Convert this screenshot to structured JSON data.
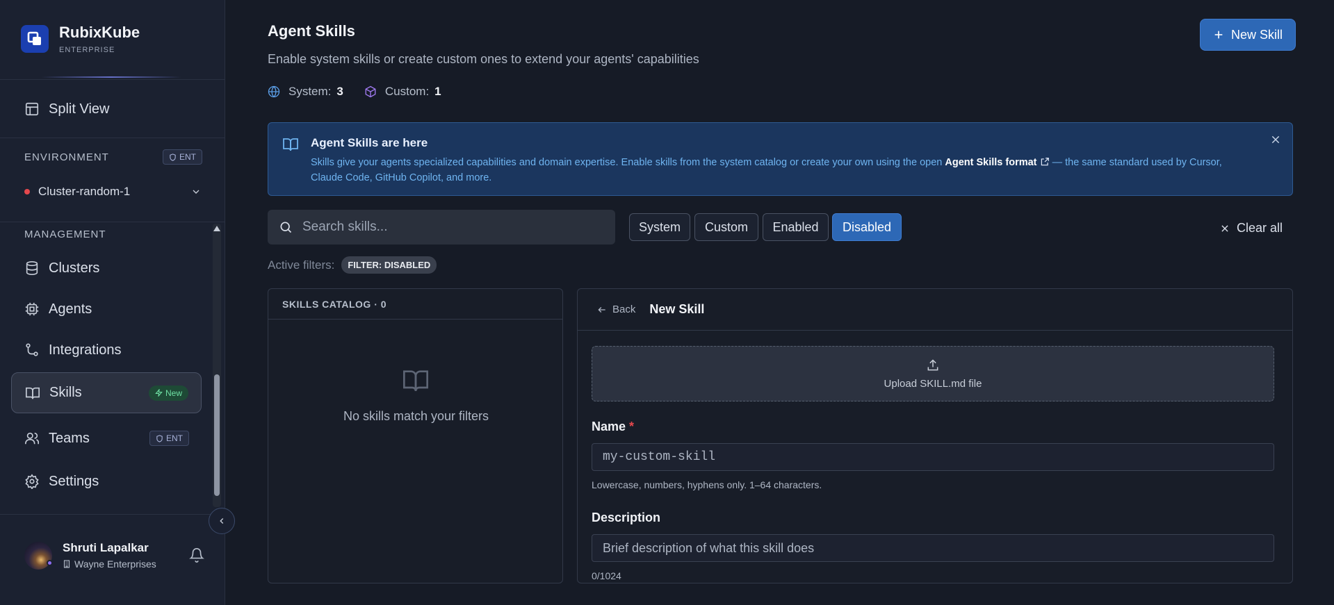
{
  "brand": {
    "name": "RubixKube",
    "sub": "ENTERPRISE"
  },
  "sidebar": {
    "split_view": "Split View",
    "environment_label": "ENVIRONMENT",
    "ent_badge": "ENT",
    "cluster": "Cluster-random-1",
    "cluster_status_color": "#e5484d",
    "management_label": "MANAGEMENT",
    "items": [
      {
        "label": "Clusters",
        "icon": "database-icon"
      },
      {
        "label": "Agents",
        "icon": "cpu-icon"
      },
      {
        "label": "Integrations",
        "icon": "git-branch-icon"
      },
      {
        "label": "Skills",
        "icon": "book-open-icon",
        "badge": "New",
        "active": true
      },
      {
        "label": "Teams",
        "icon": "users-icon",
        "badge": "ENT"
      },
      {
        "label": "Settings",
        "icon": "gear-icon"
      }
    ]
  },
  "user": {
    "name": "Shruti Lapalkar",
    "org": "Wayne Enterprises"
  },
  "header": {
    "title": "Agent Skills",
    "subtitle": "Enable system skills or create custom ones to extend your agents' capabilities",
    "system_label": "System:",
    "system_count": "3",
    "custom_label": "Custom:",
    "custom_count": "1",
    "new_skill_button": "New Skill"
  },
  "banner": {
    "title": "Agent Skills are here",
    "text_before": "Skills give your agents specialized capabilities and domain expertise. Enable skills from the system catalog or create your own using the open ",
    "link": "Agent Skills format",
    "text_after": " — the same standard used by Cursor, Claude Code, GitHub Copilot, and more."
  },
  "search": {
    "placeholder": "Search skills...",
    "value": ""
  },
  "filters": {
    "chips": [
      "System",
      "Custom",
      "Enabled",
      "Disabled"
    ],
    "active_chip": "Disabled",
    "clear_all": "Clear all",
    "active_label": "Active filters:",
    "active_tag": "FILTER: DISABLED"
  },
  "catalog": {
    "title": "SKILLS CATALOG · 0",
    "empty": "No skills match your filters"
  },
  "editor": {
    "back": "Back",
    "title": "New Skill",
    "upload": "Upload SKILL.md file",
    "name_label": "Name",
    "required_mark": "*",
    "name_placeholder": "my-custom-skill",
    "name_hint": "Lowercase, numbers, hyphens only. 1–64 characters.",
    "description_label": "Description",
    "description_placeholder": "Brief description of what this skill does",
    "description_count": "0/1024"
  },
  "colors": {
    "accent": "#2d68b6",
    "banner_bg": "#1b365e",
    "sidebar_bg": "#1b2130",
    "main_bg": "#161b26",
    "new_badge": "#6fe0a4"
  }
}
